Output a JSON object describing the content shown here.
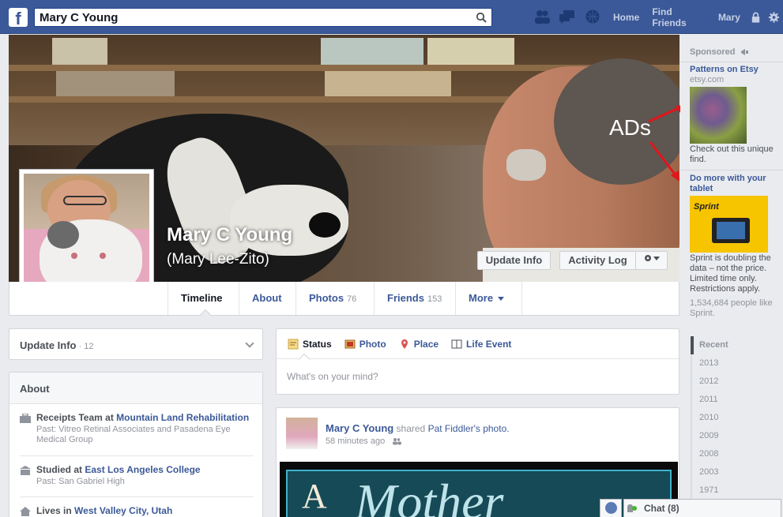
{
  "topbar": {
    "logo": "f",
    "search_value": "Mary C Young",
    "nav": [
      "Home",
      "Find Friends",
      "Mary"
    ],
    "icons": [
      "friend-requests-icon",
      "messages-icon",
      "notifications-icon",
      "lock-icon",
      "gear-icon"
    ],
    "color": "#3b5998"
  },
  "cover": {
    "name": "Mary C Young",
    "alt_name": "(Mary Lee-Zito)",
    "update_info": "Update Info",
    "activity_log": "Activity Log",
    "annotation": "ADs"
  },
  "tabs": [
    {
      "label": "Timeline",
      "count": ""
    },
    {
      "label": "About",
      "count": ""
    },
    {
      "label": "Photos",
      "count": "76"
    },
    {
      "label": "Friends",
      "count": "153"
    },
    {
      "label": "More",
      "count": ""
    }
  ],
  "update_box": {
    "label": "Update Info",
    "count": " · 12"
  },
  "about": {
    "title": "About",
    "items": [
      {
        "prefix": "Receipts Team at ",
        "link": "Mountain Land Rehabilitation",
        "sub": "Past: Vitreo Retinal Associates and Pasadena Eye Medical Group"
      },
      {
        "prefix": "Studied at ",
        "link": "East Los Angeles College",
        "sub": "Past: San Gabriel High"
      },
      {
        "prefix": "Lives in ",
        "link": "West Valley City, Utah",
        "sub": ""
      }
    ]
  },
  "composer": {
    "tabs": [
      "Status",
      "Photo",
      "Place",
      "Life Event"
    ],
    "placeholder": "What's on your mind?"
  },
  "post": {
    "author": "Mary C Young",
    "action": " shared ",
    "target": "Pat Fiddler's photo.",
    "time": "58 minutes ago",
    "image_text_1": "A",
    "image_text_2": "Mother"
  },
  "sponsored": {
    "header": "Sponsored",
    "ads": [
      {
        "title": "Patterns on Etsy",
        "domain": "etsy.com",
        "text": "Check out this unique find."
      },
      {
        "title": "Do more with your tablet",
        "brand": "Sprint",
        "text": "Sprint is doubling the data – not the price. Limited time only. Restrictions apply.",
        "likes": "1,534,684 people like Sprint."
      }
    ]
  },
  "timeline_nav": [
    "Recent",
    "2013",
    "2012",
    "2011",
    "2010",
    "2009",
    "2008",
    "2003",
    "1971"
  ],
  "chat": {
    "label": "Chat (8)"
  }
}
